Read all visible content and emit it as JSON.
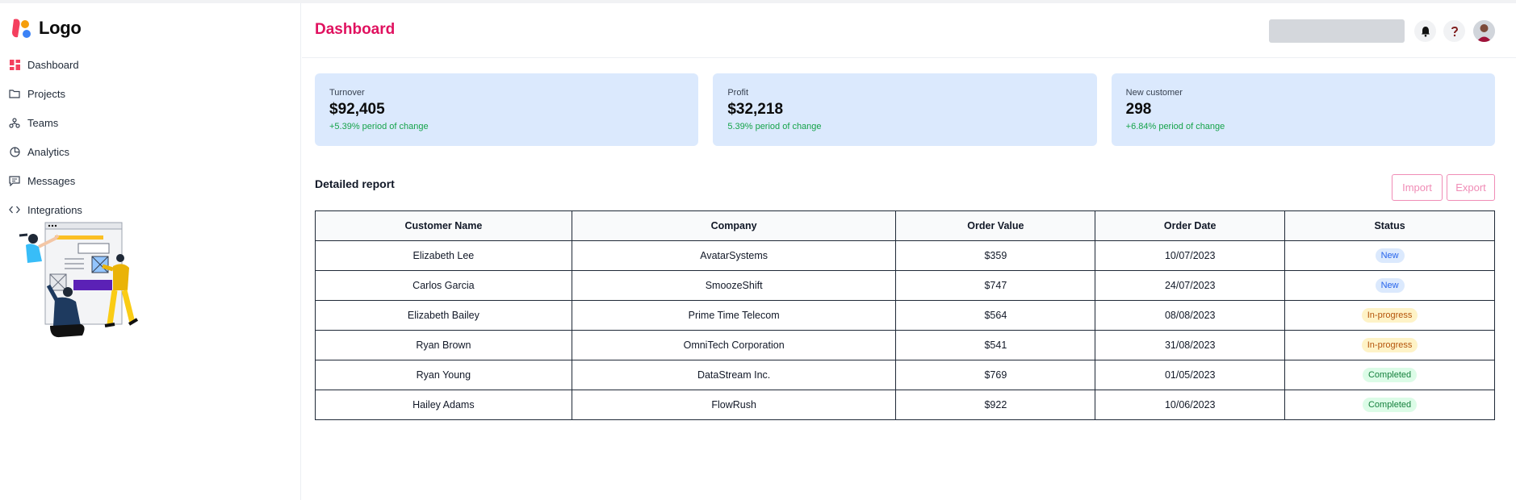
{
  "brand": {
    "name": "Logo"
  },
  "sidebar": {
    "items": [
      {
        "label": "Dashboard",
        "icon": "dashboard-icon"
      },
      {
        "label": "Projects",
        "icon": "folder-icon"
      },
      {
        "label": "Teams",
        "icon": "teams-icon"
      },
      {
        "label": "Analytics",
        "icon": "pie-chart-icon"
      },
      {
        "label": "Messages",
        "icon": "message-icon"
      },
      {
        "label": "Integrations",
        "icon": "code-icon"
      }
    ]
  },
  "header": {
    "title": "Dashboard",
    "icons": [
      "bell-icon",
      "help-icon",
      "avatar"
    ]
  },
  "stats": [
    {
      "label": "Turnover",
      "value": "$92,405",
      "change": "+5.39% period of change"
    },
    {
      "label": "Profit",
      "value": "$32,218",
      "change": "5.39% period of change"
    },
    {
      "label": "New customer",
      "value": "298",
      "change": "+6.84% period of change"
    }
  ],
  "report": {
    "title": "Detailed report",
    "import_label": "Import",
    "export_label": "Export",
    "columns": [
      "Customer Name",
      "Company",
      "Order Value",
      "Order Date",
      "Status"
    ],
    "rows": [
      {
        "name": "Elizabeth Lee",
        "company": "AvatarSystems",
        "value": "$359",
        "date": "10/07/2023",
        "status": "New"
      },
      {
        "name": "Carlos Garcia",
        "company": "SmoozeShift",
        "value": "$747",
        "date": "24/07/2023",
        "status": "New"
      },
      {
        "name": "Elizabeth Bailey",
        "company": "Prime Time Telecom",
        "value": "$564",
        "date": "08/08/2023",
        "status": "In-progress"
      },
      {
        "name": "Ryan Brown",
        "company": "OmniTech Corporation",
        "value": "$541",
        "date": "31/08/2023",
        "status": "In-progress"
      },
      {
        "name": "Ryan Young",
        "company": "DataStream Inc.",
        "value": "$769",
        "date": "01/05/2023",
        "status": "Completed"
      },
      {
        "name": "Hailey Adams",
        "company": "FlowRush",
        "value": "$922",
        "date": "10/06/2023",
        "status": "Completed"
      }
    ]
  },
  "colors": {
    "accent": "#e0115f",
    "card_bg": "#dbe9fd",
    "positive": "#16a34a",
    "outline_button": "#f08cb6"
  }
}
